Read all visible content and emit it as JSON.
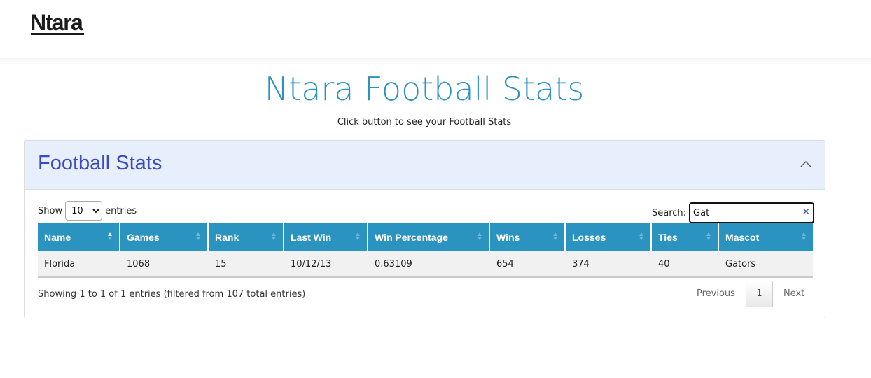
{
  "brand": {
    "logo_text": "Ntara"
  },
  "hero": {
    "title": "Ntara Football Stats",
    "subtitle": "Click button to see your Football Stats"
  },
  "card": {
    "title": "Football Stats",
    "collapse_icon": "chevron-up-icon"
  },
  "length_control": {
    "show_label": "Show",
    "selected": "10",
    "entries_label": "entries"
  },
  "search": {
    "label": "Search:",
    "value": "Gat",
    "clear_icon": "close-icon"
  },
  "table": {
    "columns": [
      "Name",
      "Games",
      "Rank",
      "Last Win",
      "Win Percentage",
      "Wins",
      "Losses",
      "Ties",
      "Mascot"
    ],
    "rows": [
      [
        "Florida",
        "1068",
        "15",
        "10/12/13",
        "0.63109",
        "654",
        "374",
        "40",
        "Gators"
      ]
    ]
  },
  "info_text": "Showing 1 to 1 of 1 entries (filtered from 107 total entries)",
  "pagination": {
    "previous": "Previous",
    "current_page": "1",
    "next": "Next"
  },
  "colors": {
    "accent": "#2b93bf",
    "card_title": "#3a4ac4",
    "card_header_bg": "#e7eefc"
  }
}
